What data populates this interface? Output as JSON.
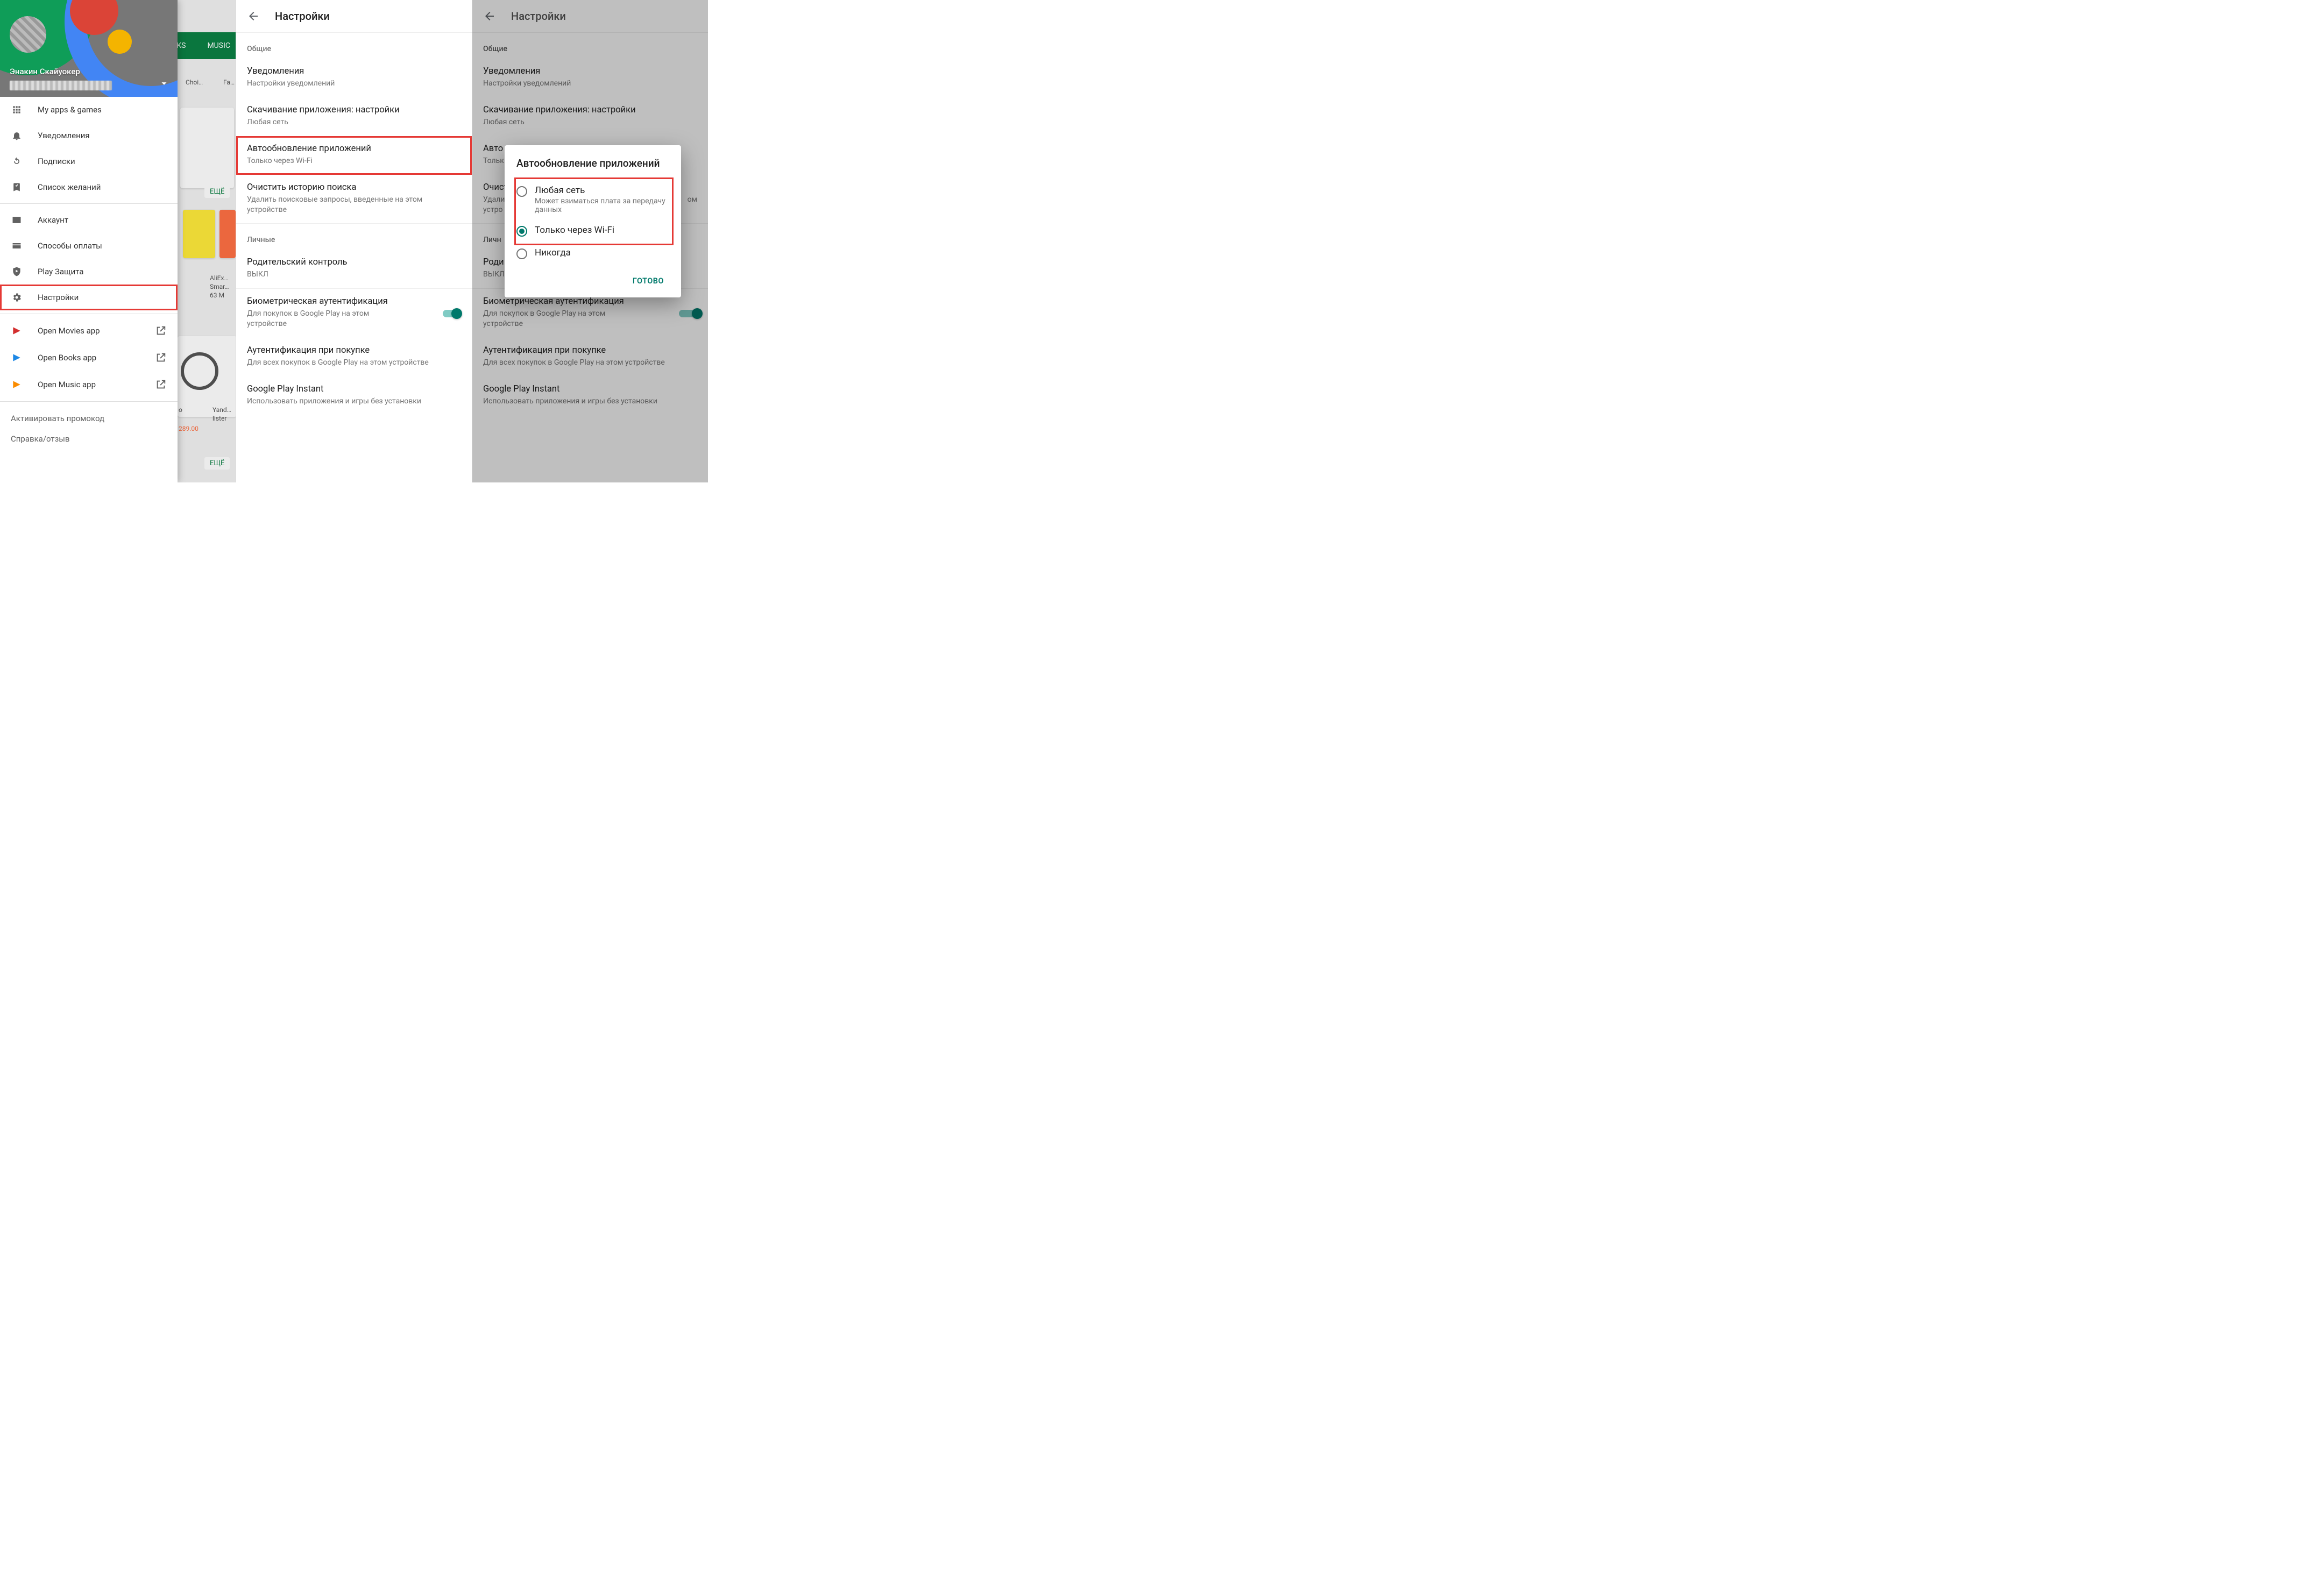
{
  "panel1": {
    "bg": {
      "tab_books": "KS",
      "tab_music": "MUSIC",
      "more": "ЕЩЁ",
      "choice": "Choi…",
      "family": "Fa…",
      "aliex": "AliEx…",
      "smart": "Smar…",
      "size": "63 M",
      "yand": "Yand…",
      "lister": "lister",
      "price": "289.00",
      "o": "o"
    },
    "user_name": "Энакин Скайуокер",
    "groups": {
      "a": [
        {
          "icon": "apps",
          "label": "My apps & games"
        },
        {
          "icon": "bell",
          "label": "Уведомления"
        },
        {
          "icon": "refresh",
          "label": "Подписки"
        },
        {
          "icon": "bookmark",
          "label": "Список желаний"
        }
      ],
      "b": [
        {
          "icon": "account",
          "label": "Аккаунт"
        },
        {
          "icon": "card",
          "label": "Способы оплаты"
        },
        {
          "icon": "shield",
          "label": "Play Защита"
        },
        {
          "icon": "gear",
          "label": "Настройки",
          "highlight": true
        }
      ],
      "c": [
        {
          "icon": "movies",
          "label": "Open Movies app",
          "launch": true,
          "tint": "red-ic"
        },
        {
          "icon": "books",
          "label": "Open Books app",
          "launch": true,
          "tint": "blue-ic"
        },
        {
          "icon": "music",
          "label": "Open Music app",
          "launch": true,
          "tint": "orange-ic"
        }
      ]
    },
    "footer": {
      "promo": "Активировать промокод",
      "help": "Справка/отзыв"
    }
  },
  "panel2": {
    "title": "Настройки",
    "section_general": "Общие",
    "items_general": [
      {
        "t1": "Уведомления",
        "t2": "Настройки уведомлений"
      },
      {
        "t1": "Скачивание приложения: настройки",
        "t2": "Любая сеть"
      },
      {
        "t1": "Автообновление приложений",
        "t2": "Только через Wi-Fi",
        "highlight": true
      },
      {
        "t1": "Очистить историю поиска",
        "t2": "Удалить поисковые запросы, введенные на этом устройстве"
      }
    ],
    "section_personal": "Личные",
    "items_personal": [
      {
        "t1": "Родительский контроль",
        "t2": "ВЫКЛ"
      },
      {
        "t1": "Биометрическая аутентификация",
        "t2": "Для покупок в Google Play на этом устройстве",
        "toggle": true
      },
      {
        "t1": "Аутентификация при покупке",
        "t2": "Для всех покупок в Google Play на этом устройстве"
      },
      {
        "t1": "Google Play Instant",
        "t2": "Использовать приложения и игры без установки"
      }
    ]
  },
  "panel3": {
    "title": "Настройки",
    "section_general": "Общие",
    "under_general": [
      {
        "t1": "Уведомления",
        "t2": "Настройки уведомлений"
      },
      {
        "t1": "Скачивание приложения: настройки",
        "t2": "Любая сеть"
      },
      {
        "t1": "Авто",
        "t2": "Тольк"
      },
      {
        "t1": "Очист",
        "t2": "Удали",
        "t3": "устро"
      }
    ],
    "section_personal": "Личн",
    "under_personal": [
      {
        "t1": "Роди",
        "t2": "ВЫКЛ"
      },
      {
        "t1": "Биометрическая аутентификация",
        "t2": "Для покупок в Google Play на этом устройстве",
        "toggle": true
      },
      {
        "t1": "Аутентификация при покупке",
        "t2": "Для всех покупок в Google Play на этом устройстве"
      },
      {
        "t1": "Google Play Instant",
        "t2": "Использовать приложения и игры без установки"
      }
    ],
    "dialog": {
      "title": "Автообновление приложений",
      "options": [
        {
          "t1": "Любая сеть",
          "t2": "Может взиматься плата за передачу данных",
          "checked": false
        },
        {
          "t1": "Только через Wi-Fi",
          "checked": true
        },
        {
          "t1": "Никогда",
          "checked": false
        }
      ],
      "done": "ГОТОВО"
    }
  },
  "trunc_om": "ом"
}
